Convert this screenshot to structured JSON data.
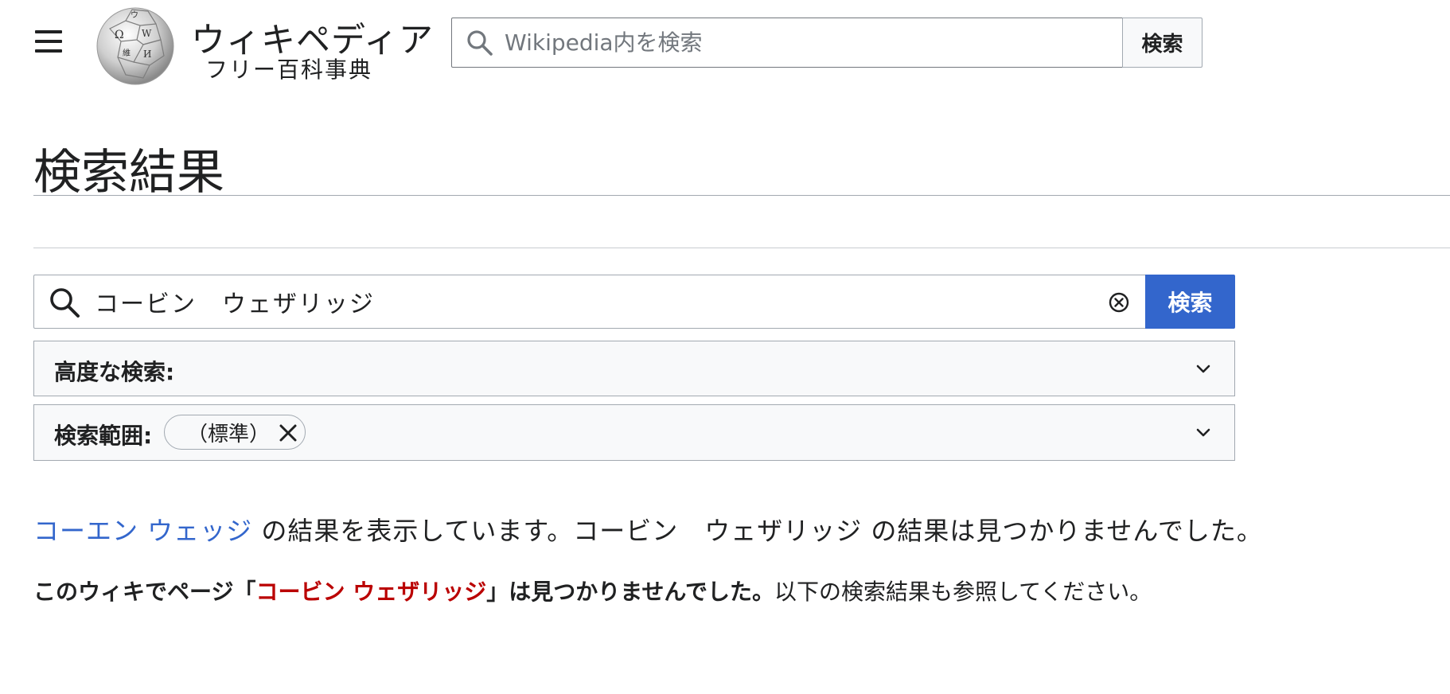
{
  "header": {
    "menu_icon": "hamburger-menu-icon",
    "logo_icon": "wikipedia-globe-icon",
    "wordmark": "ウィキペディア",
    "tagline": "フリー百科事典",
    "search": {
      "placeholder": "Wikipedia内を検索",
      "value": "",
      "icon": "search-icon",
      "button_label": "検索"
    }
  },
  "page": {
    "title": "検索結果"
  },
  "main_search": {
    "value": "コービン　ウェザリッジ",
    "icon": "search-icon",
    "clear_icon": "clear-circle-x-icon",
    "button_label": "検索",
    "button_color": "#3366cc"
  },
  "advanced_search": {
    "label": "高度な検索:",
    "chevron_icon": "chevron-down-icon"
  },
  "namespaces": {
    "label": "検索範囲:",
    "chip_label": "（標準）",
    "chip_remove_icon": "close-icon",
    "chevron_icon": "chevron-down-icon"
  },
  "results": {
    "suggestion_link": "コーエン ウェッジ",
    "suggestion_text": " の結果を表示しています。コービン　ウェザリッジ の結果は見つかりませんでした。",
    "notfound_prefix": "このウィキでページ「",
    "notfound_redlink": "コービン ウェザリッジ",
    "notfound_suffix": "」は見つかりませんでした。",
    "notfound_rest": "以下の検索結果も参照してください。",
    "link_color": "#3366cc",
    "redlink_color": "#ba0000"
  }
}
